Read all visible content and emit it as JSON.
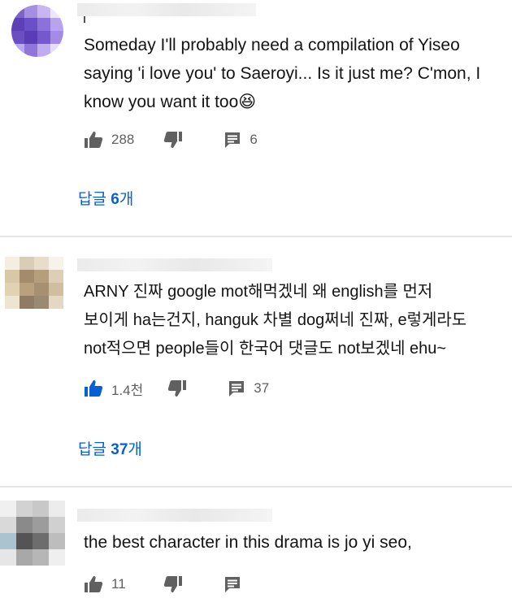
{
  "colors": {
    "accent_blue": "#065fd4",
    "text": "#141414",
    "meta": "#606060",
    "divider": "#e5e5e5"
  },
  "comments": [
    {
      "lines": [
        "Someday I'll probably need a compilation of Yiseo",
        "saying 'i love you' to Saeroyi... Is it just me? C'mon, I",
        "know you want it too😆"
      ],
      "likes": "288",
      "reply_count": "6",
      "replies_label": "답글 6개",
      "liked": false
    },
    {
      "lines": [
        "ARNY 진짜 google mot해먹겠네 왜 english를 먼저",
        "보이게 ha는건지, hanguk 차별 dog쩌네 진짜,  e렇게라도",
        "not적으면 people들이 한국어 댓글도 not보겠네 ehu~"
      ],
      "likes": "1.4천",
      "reply_count": "37",
      "replies_label": "답글 37개",
      "liked": true
    },
    {
      "lines": [
        "the best character in this drama is jo yi seo,"
      ],
      "likes": "11",
      "reply_count": "",
      "liked": false
    }
  ]
}
